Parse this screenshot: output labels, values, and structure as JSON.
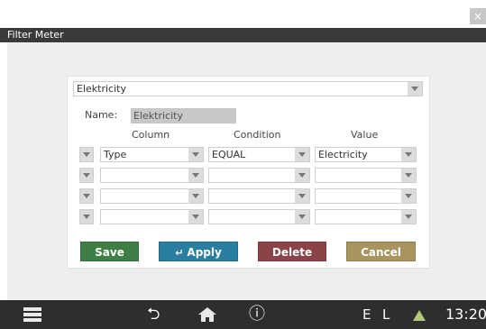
{
  "window": {
    "close_glyph": "×",
    "title": "Filter Meter"
  },
  "filter": {
    "meter_select": "Elektricity",
    "name_label": "Name:",
    "name_value": "Elektricity",
    "columns": {
      "column": "Column",
      "condition": "Condition",
      "value": "Value"
    },
    "rows": [
      {
        "column": "Type",
        "condition": "EQUAL",
        "value": "Electricity"
      },
      {
        "column": "",
        "condition": "",
        "value": ""
      },
      {
        "column": "",
        "condition": "",
        "value": ""
      },
      {
        "column": "",
        "condition": "",
        "value": ""
      }
    ]
  },
  "buttons": {
    "save": "Save",
    "apply": "Apply",
    "delete": "Delete",
    "cancel": "Cancel"
  },
  "button_colors": {
    "save": "#3f7f46",
    "apply": "#2a7ea0",
    "delete": "#8a4448",
    "cancel": "#a8945e"
  },
  "statusbar": {
    "info_glyph": "ⓘ",
    "back_glyph": "⮌",
    "indicator_e": "E",
    "indicator_l": "L",
    "time": "13:20",
    "icons": [
      "menu-icon",
      "back-icon",
      "home-icon",
      "info-icon",
      "warning-icon"
    ]
  }
}
